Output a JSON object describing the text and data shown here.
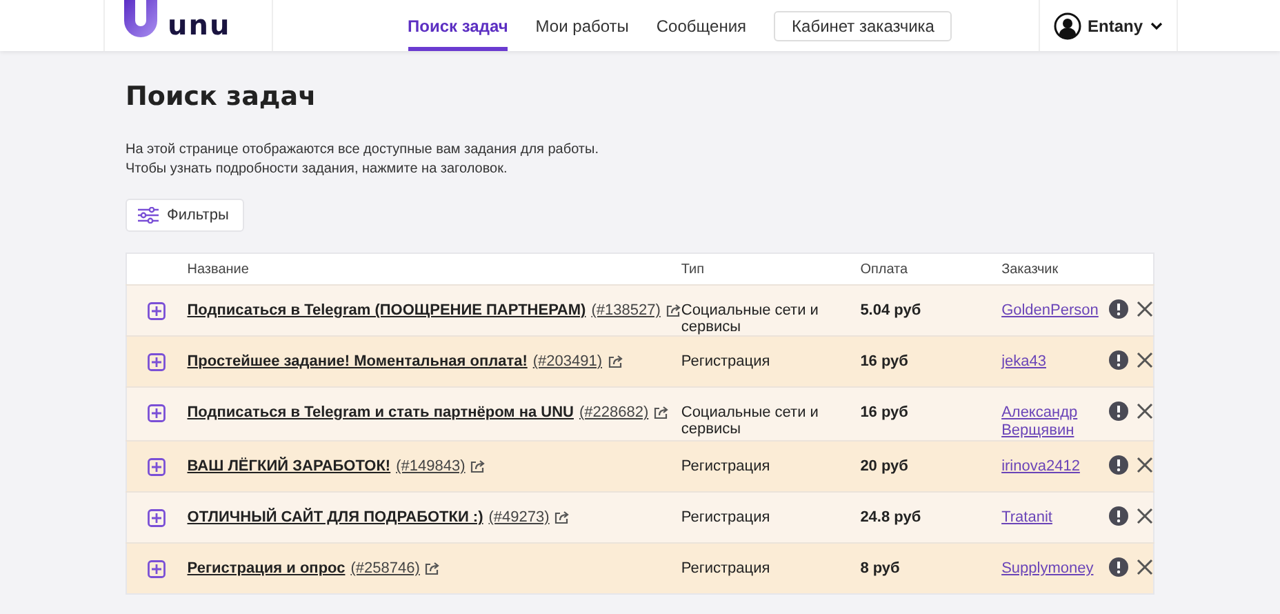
{
  "header": {
    "logo": "unu",
    "nav": [
      {
        "label": "Поиск задач",
        "selected": true
      },
      {
        "label": "Мои работы",
        "selected": false
      },
      {
        "label": "Сообщения",
        "selected": false
      }
    ],
    "customer_button": "Кабинет заказчика",
    "user": "Entany"
  },
  "title": "Поиск задач",
  "description": [
    "На этой странице отображаются все доступные вам задания для работы.",
    "Чтобы узнать подробности задания, нажмите на заголовок."
  ],
  "filters_button": "Фильтры",
  "table": {
    "columns": [
      "Название",
      "Тип",
      "Оплата",
      "Заказчик"
    ],
    "rows": [
      {
        "title": "Подписаться в Telegram (ПООЩРЕНИЕ ПАРТНЕРАМ)",
        "id": "(#138527)",
        "type": "Социальные сети и сервисы",
        "pay": "5.04 руб",
        "customer": "GoldenPerson"
      },
      {
        "title": "Простейшее задание! Моментальная оплата!",
        "id": "(#203491)",
        "type": "Регистрация",
        "pay": "16 руб",
        "customer": "jeka43"
      },
      {
        "title": "Подписаться в Telegram и стать партнёром на UNU",
        "id": "(#228682)",
        "type": "Социальные сети и сервисы",
        "pay": "16 руб",
        "customer": "Александр Верщявин"
      },
      {
        "title": "ВАШ ЛЁГКИЙ ЗАРАБОТОК!",
        "id": "(#149843)",
        "type": "Регистрация",
        "pay": "20 руб",
        "customer": "irinova2412"
      },
      {
        "title": "ОТЛИЧНЫЙ САЙТ ДЛЯ ПОДРАБОТКИ :)",
        "id": "(#49273)",
        "type": "Регистрация",
        "pay": "24.8 руб",
        "customer": "Tratanit"
      },
      {
        "title": "Регистрация и опрос",
        "id": "(#258746)",
        "type": "Регистрация",
        "pay": "8 руб",
        "customer": "Supplymoney"
      }
    ]
  }
}
